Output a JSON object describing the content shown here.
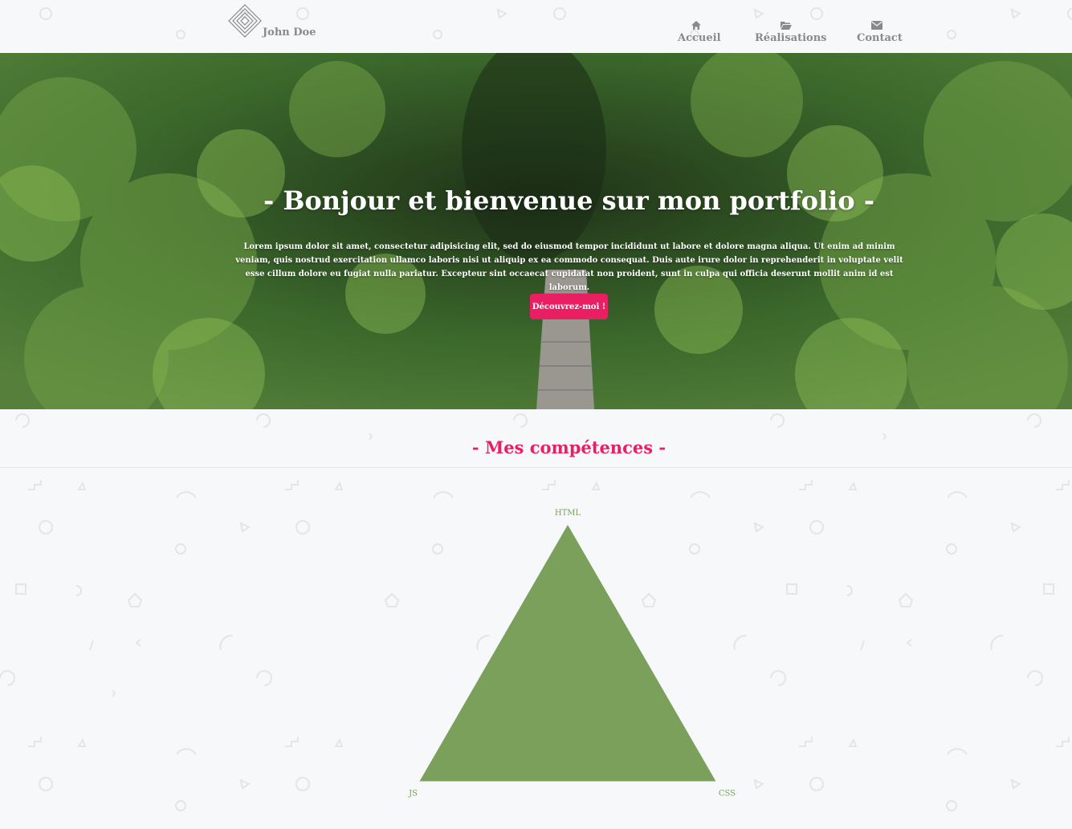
{
  "header": {
    "brand": "John Doe",
    "nav": [
      {
        "label": "Accueil",
        "icon": "home-icon"
      },
      {
        "label": "Réalisations",
        "icon": "folder-open-icon"
      },
      {
        "label": "Contact",
        "icon": "envelope-icon"
      }
    ]
  },
  "hero": {
    "title": "- Bonjour et bienvenue sur mon portfolio -",
    "text": "Lorem ipsum dolor sit amet, consectetur adipisicing elit, sed do eiusmod tempor incididunt ut labore et dolore magna aliqua. Ut enim ad minim veniam, quis nostrud exercitation ullamco laboris nisi ut aliquip ex ea commodo consequat. Duis aute irure dolor in reprehenderit in voluptate velit esse cillum dolore eu fugiat nulla pariatur. Excepteur sint occaecat cupidatat non proident, sunt in culpa qui officia deserunt mollit anim id est laborum.",
    "cta": "Découvrez-moi !"
  },
  "skills": {
    "title": "- Mes compétences -"
  },
  "colors": {
    "accent": "#e91e63",
    "chart_fill": "#7ba05b",
    "nav_text": "#8a8a8a"
  },
  "chart_data": {
    "type": "radar",
    "axes": [
      "HTML",
      "CSS",
      "JS"
    ],
    "values": [
      1,
      1,
      1
    ],
    "max": 1
  }
}
